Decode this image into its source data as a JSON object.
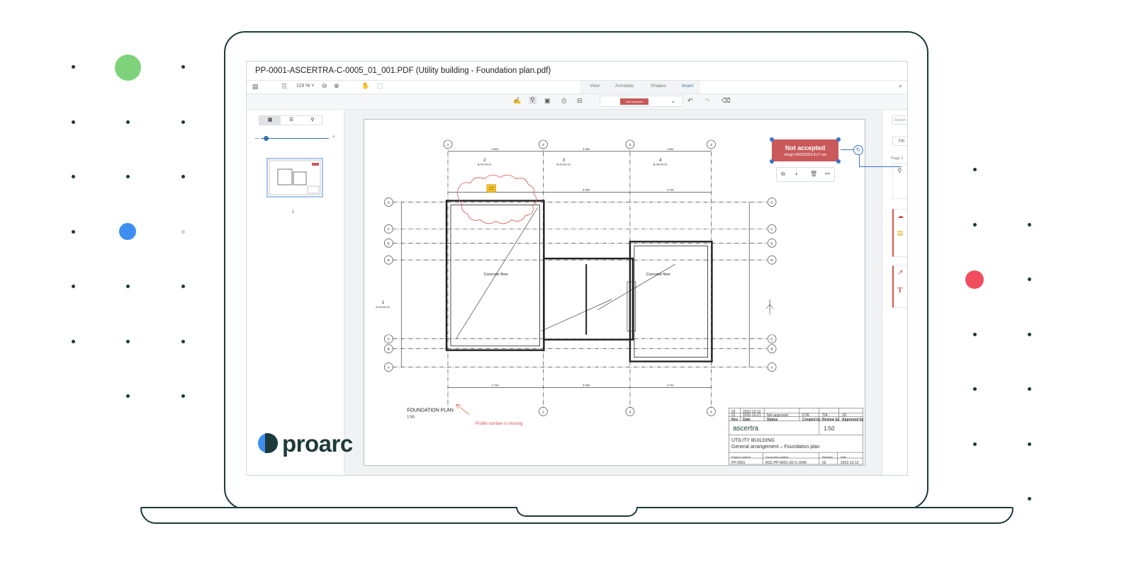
{
  "window": {
    "title": "PP-0001-ASCERTRA-C-0005_01_001.PDF (Utility building - Foundation plan.pdf)"
  },
  "toolbar": {
    "zoom": "119 %",
    "tabs": [
      "View",
      "Annotate",
      "Shapes",
      "Insert"
    ],
    "active_tab": "Insert",
    "stamp_preview": "Not accepted"
  },
  "left_panel": {
    "page_label": "1"
  },
  "right_panel": {
    "search_placeholder": "Search",
    "filter_label": "Filt",
    "page_label": "Page 1"
  },
  "stamp": {
    "title": "Not accepted",
    "subtitle": "erlngh 09/05/2023 8:17 am"
  },
  "drawing": {
    "plan_title": "FOUNDATION PLAN",
    "scale": "1:50",
    "comment": "Profile number is missing",
    "room_left": "Concrete floor",
    "room_right": "Concrete floor",
    "axis_numbers": [
      "1",
      "2",
      "3",
      "4"
    ],
    "axis_letters": [
      "G",
      "F",
      "E",
      "D",
      "C",
      "B",
      "A"
    ],
    "section_2": "2",
    "section_2_ref": "B-43-00-01",
    "section_3": "3",
    "section_3_ref": "B-43-00-01",
    "section_4": "4",
    "section_4_ref": "B-43-00-01",
    "section_1": "1",
    "section_1_ref": "B-43-00-01",
    "dims_top": [
      "3 590",
      "3 660",
      "3 590"
    ],
    "dims_mid": [
      "5 850",
      "3 790"
    ],
    "dims_bottom": [
      "3 790",
      "5 850",
      "3 790"
    ]
  },
  "title_block": {
    "rows": [
      [
        "02",
        "2022-12-12",
        "",
        "",
        "",
        ""
      ],
      [
        "01",
        "2020-10-21",
        "Not approved",
        "DTE",
        "TIA",
        "JO"
      ],
      [
        "Rev",
        "Date",
        "Status",
        "Created by",
        "Review by",
        "Approved by"
      ]
    ],
    "company": "ascertra",
    "scale": "1:50",
    "title_line1": "UTILITY BUILDING",
    "title_line2": "General arrangement – Foundation plan",
    "footer_labels": [
      "Project number",
      "Document number",
      "Revision",
      "Date"
    ],
    "footer_values": [
      "PP-0001",
      "ASC-PP-0001-XD-C-0340",
      "02",
      "2022-12-12"
    ]
  },
  "brand": {
    "name": "proarc"
  },
  "colors": {
    "frame": "#1e3a3a",
    "green": "#7ed37a",
    "blue": "#3d8ef0",
    "red": "#f04e5e",
    "stamp_red": "#c9595a",
    "cloud_red": "#d9534f"
  }
}
